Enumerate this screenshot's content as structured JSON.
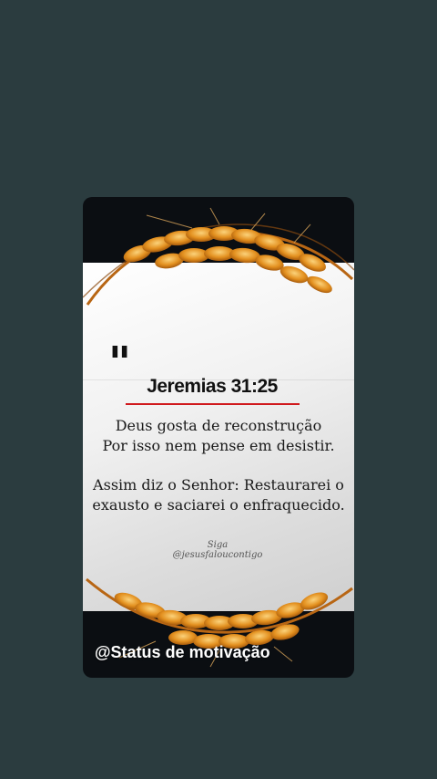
{
  "post": {
    "quote_mark": "\"",
    "reference": "Jeremias 31:25",
    "line1": "Deus gosta de reconstrução",
    "line2": "Por isso nem pense em desistir.",
    "verse": "Assim diz o Senhor: Restaurarei o exausto e saciarei o enfraquecido.",
    "signature": "Siga @jesusfaloucontigo",
    "watermark": "@Status de motivação"
  },
  "colors": {
    "background": "#2b3c3f",
    "underline": "#d0191d",
    "wheat": "#e08a1e"
  }
}
